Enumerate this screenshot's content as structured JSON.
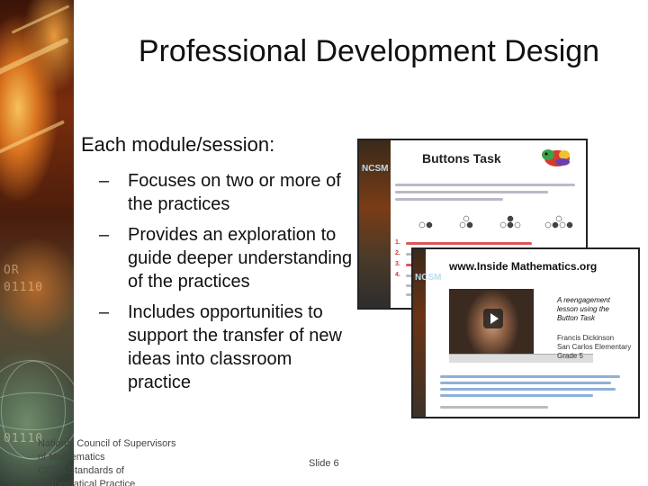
{
  "slide": {
    "title": "Professional Development Design",
    "main_point": "Each module/session:",
    "sub_points": [
      "Focuses on two or more of the practices",
      "Provides an exploration to guide deeper understanding of the practices",
      "Includes opportunities to support the transfer of new ideas into classroom practice"
    ],
    "bullet_dash": "–",
    "footer": {
      "line1": "National Council of Supervisors",
      "line2": "of Mathematics",
      "line3": "CCSS Standards of",
      "line4": "Mathematical Practice",
      "slide_number": "Slide 6"
    }
  },
  "left_strip": {
    "binary_1": "OR",
    "binary_2": "01110",
    "binary_3": "01110"
  },
  "screenshot_1": {
    "logo": "NCSM",
    "heading": "Buttons Task",
    "list_numbers": [
      "1.",
      "2.",
      "3.",
      "4."
    ]
  },
  "screenshot_2": {
    "logo": "NCSM",
    "url": "www.Inside Mathematics.org",
    "description_1": "A reengagement",
    "description_2": "lesson using the",
    "description_3": "Button Task",
    "teacher_1": "Francis Dickinson",
    "teacher_2": "San Carlos Elementary",
    "teacher_3": "Grade 5"
  }
}
